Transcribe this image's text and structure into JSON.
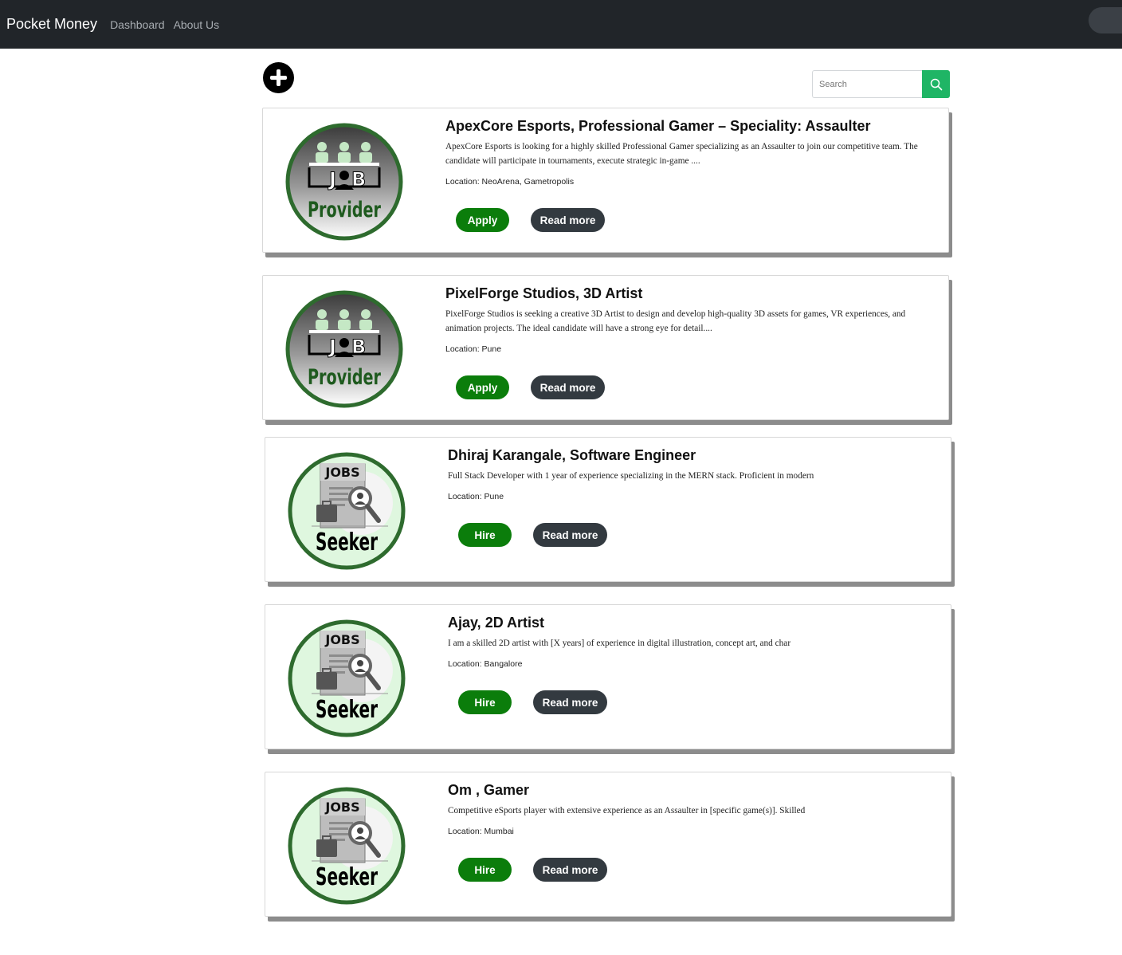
{
  "navbar": {
    "brand": "Pocket Money",
    "links": [
      "Dashboard",
      "About Us"
    ]
  },
  "search": {
    "placeholder": "Search",
    "button_icon": "search-icon"
  },
  "add_button_icon": "plus-circle-icon",
  "colors": {
    "navbar_bg": "#212529",
    "primary_green": "#0b7d0b",
    "search_green": "#1fb565",
    "dark_button": "#333a40",
    "logo_ring": "#2e6b2e"
  },
  "cards": [
    {
      "logo": "JOB Provider",
      "logo_lines": [
        "J",
        "B",
        "Provider"
      ],
      "title": "ApexCore Esports, Professional Gamer – Speciality: Assaulter",
      "description": "ApexCore Esports is looking for a highly skilled Professional Gamer specializing as an Assaulter to join our competitive team. The candidate will participate in tournaments, execute strategic in-game ....",
      "location": "Location: NeoArena, Gametropolis",
      "action_label": "Apply",
      "read_more_label": "Read more"
    },
    {
      "logo": "JOB Provider",
      "logo_lines": [
        "J",
        "B",
        "Provider"
      ],
      "title": "PixelForge Studios, 3D Artist",
      "description": "PixelForge Studios is seeking a creative 3D Artist to design and develop high-quality 3D assets for games, VR experiences, and animation projects. The ideal candidate will have a strong eye for detail....",
      "location": "Location: Pune",
      "action_label": "Apply",
      "read_more_label": "Read more"
    },
    {
      "logo": "JOBS Seeker",
      "logo_lines": [
        "JOBS",
        "Seeker"
      ],
      "title": "Dhiraj Karangale, Software Engineer",
      "description": "Full Stack Developer with 1 year of experience specializing in the MERN stack. Proficient in modern",
      "location": "Location: Pune",
      "action_label": "Hire",
      "read_more_label": "Read more"
    },
    {
      "logo": "JOBS Seeker",
      "logo_lines": [
        "JOBS",
        "Seeker"
      ],
      "title": "Ajay, 2D Artist",
      "description": "I am a skilled 2D artist with [X years] of experience in digital illustration, concept art, and char",
      "location": "Location: Bangalore",
      "action_label": "Hire",
      "read_more_label": "Read more"
    },
    {
      "logo": "JOBS Seeker",
      "logo_lines": [
        "JOBS",
        "Seeker"
      ],
      "title": "Om , Gamer",
      "description": "Competitive eSports player with extensive experience as an Assaulter in [specific game(s)]. Skilled",
      "location": "Location: Mumbai",
      "action_label": "Hire",
      "read_more_label": "Read more"
    }
  ]
}
